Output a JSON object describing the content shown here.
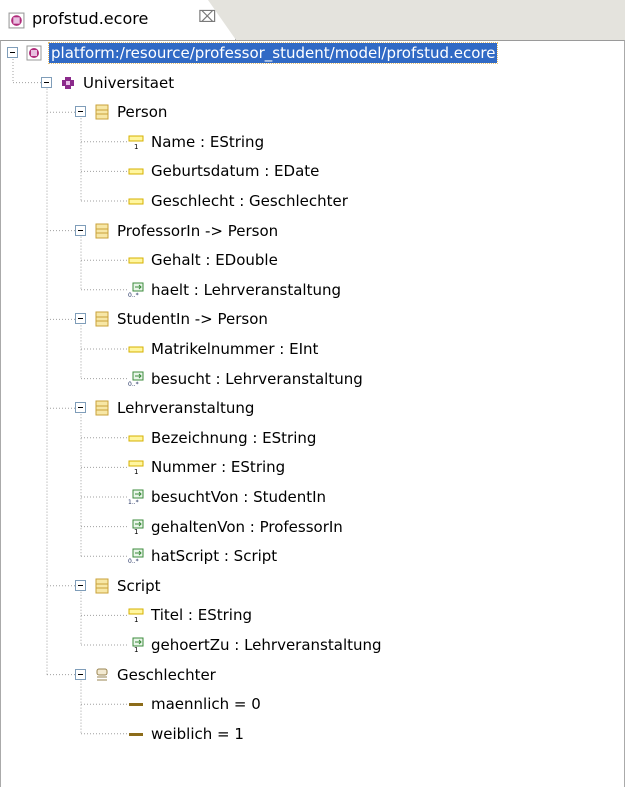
{
  "tab": {
    "title": "profstud.ecore",
    "close_glyph": "⌧"
  },
  "tree": {
    "root": "platform:/resource/professor_student/model/profstud.ecore",
    "package": "Universitaet",
    "classes": [
      {
        "name": "Person",
        "features": [
          {
            "label": "Name : EString",
            "kind": "id-attribute"
          },
          {
            "label": "Geburtsdatum : EDate",
            "kind": "attribute"
          },
          {
            "label": "Geschlecht : Geschlechter",
            "kind": "attribute"
          }
        ]
      },
      {
        "name": "ProfessorIn -> Person",
        "features": [
          {
            "label": "Gehalt : EDouble",
            "kind": "attribute"
          },
          {
            "label": "haelt : Lehrveranstaltung",
            "kind": "reference-many"
          }
        ]
      },
      {
        "name": "StudentIn -> Person",
        "features": [
          {
            "label": "Matrikelnummer : EInt",
            "kind": "attribute"
          },
          {
            "label": "besucht : Lehrveranstaltung",
            "kind": "reference-many"
          }
        ]
      },
      {
        "name": "Lehrveranstaltung",
        "features": [
          {
            "label": "Bezeichnung : EString",
            "kind": "attribute"
          },
          {
            "label": "Nummer : EString",
            "kind": "id-attribute"
          },
          {
            "label": "besuchtVon : StudentIn",
            "kind": "reference-required-many"
          },
          {
            "label": "gehaltenVon : ProfessorIn",
            "kind": "reference-one"
          },
          {
            "label": "hatScript : Script",
            "kind": "reference-many"
          }
        ]
      },
      {
        "name": "Script",
        "features": [
          {
            "label": "Titel : EString",
            "kind": "id-attribute"
          },
          {
            "label": "gehoertZu : Lehrveranstaltung",
            "kind": "reference-one"
          }
        ]
      }
    ],
    "enum": {
      "name": "Geschlechter",
      "literals": [
        {
          "label": "maennlich = 0"
        },
        {
          "label": "weiblich = 1"
        }
      ]
    }
  },
  "icons": {
    "resource": "ecore-resource-icon",
    "package": "epackage-icon",
    "class": "eclass-icon",
    "attribute": "eattribute-icon",
    "id-attribute": "eattribute-id-icon",
    "reference-many": "ereference-many-icon",
    "reference-required-many": "ereference-required-many-icon",
    "reference-one": "ereference-one-icon",
    "enum": "eenum-icon",
    "literal": "eenum-literal-icon"
  },
  "colors": {
    "selection": "#316ac5",
    "class_icon": "#c8a23a",
    "attribute_icon": "#d6b000",
    "reference_icon": "#3b8b3b",
    "package_icon": "#8b2a8b"
  }
}
